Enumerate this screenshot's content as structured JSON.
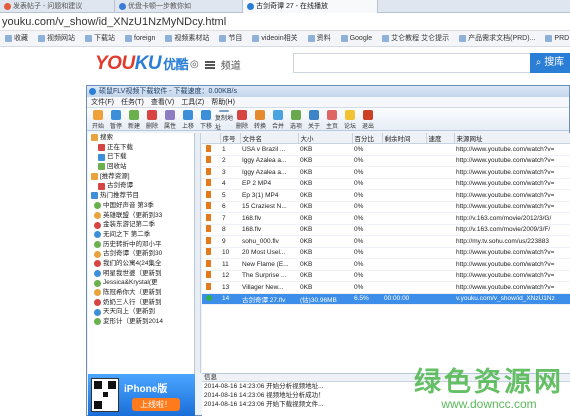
{
  "browser": {
    "tabs": [
      "发表帖子 - 问题和建议",
      "优盘卡顿一步教你如",
      "古剑奇谭 27 - 在线播放"
    ],
    "url": "youku.com/v_show/id_XNzU1NzMyNDcy.html",
    "bookmarks": [
      "收藏",
      "视频网站",
      "下载站",
      "foreign",
      "视频素材站",
      "节目",
      "videoin相关",
      "资料",
      "Google",
      "艾仑教程 艾仑提示",
      "产品需求文档(PRD)...",
      "PRD | 人人都"
    ]
  },
  "youku": {
    "logo_you": "YOU",
    "logo_ku": "KU",
    "logo_cn": "优酷",
    "nav_label": "频道",
    "search_button": "搜库"
  },
  "downloader": {
    "title": "硕鼠FLV视频下载软件 - 下载速度：0.00KB/s",
    "menus": [
      "文件(F)",
      "任务(T)",
      "查看(V)",
      "工具(Z)",
      "帮助(H)"
    ],
    "toolbar": [
      "开始",
      "暂停",
      "新建",
      "删除",
      "属性",
      "上移",
      "下移",
      "复制地址",
      "删除",
      "转换",
      "合并",
      "选项",
      "关于",
      "主页",
      "论坛",
      "退出"
    ],
    "tree": [
      {
        "label": "搜索",
        "level": 0
      },
      {
        "label": "正在下载",
        "level": 1
      },
      {
        "label": "已下载",
        "level": 1
      },
      {
        "label": "回收站",
        "level": 1
      },
      {
        "label": "[推荐资源]",
        "level": 0
      },
      {
        "label": "古剑奇谭",
        "level": 1
      },
      {
        "label": "热门推荐节目",
        "level": 0
      },
      {
        "label": "中国好声音 第3季",
        "level": 2
      },
      {
        "label": "英雄联盟（更新到33",
        "level": 2
      },
      {
        "label": "金装东游记第二季",
        "level": 2
      },
      {
        "label": "无间之下 第二季",
        "level": 2
      },
      {
        "label": "历史转折中的邓小平",
        "level": 2
      },
      {
        "label": "古剑奇谭（更新到30",
        "level": 2
      },
      {
        "label": "我们的公寓4(24集全",
        "level": 2
      },
      {
        "label": "明星我世婆（更新到",
        "level": 2
      },
      {
        "label": "Jessica&Krystal(更",
        "level": 2
      },
      {
        "label": "陈冠希你大（更新到",
        "level": 2
      },
      {
        "label": "奶奶三人行（更新到",
        "level": 2
      },
      {
        "label": "天天向上（更新到",
        "level": 2
      },
      {
        "label": "変形计（更新到2014",
        "level": 2
      }
    ],
    "columns": [
      "",
      "序号",
      "文件名",
      "大小",
      "百分比",
      "剩余时间",
      "速度",
      "来源网址"
    ],
    "rows": [
      [
        "1",
        "USA v Brazil ...",
        "0KB",
        "0%",
        "",
        "",
        "http://www.youtube.com/watch?v="
      ],
      [
        "2",
        "Iggy Azalea a...",
        "0KB",
        "0%",
        "",
        "",
        "http://www.youtube.com/watch?v="
      ],
      [
        "3",
        "Iggy Azalea a...",
        "0KB",
        "0%",
        "",
        "",
        "http://www.youtube.com/watch?v="
      ],
      [
        "4",
        "EP 2 MP4",
        "0KB",
        "0%",
        "",
        "",
        "http://www.youtube.com/watch?v="
      ],
      [
        "5",
        "Ep 3(1) MP4",
        "0KB",
        "0%",
        "",
        "",
        "http://www.youtube.com/watch?v="
      ],
      [
        "6",
        "15 Craziest N...",
        "0KB",
        "0%",
        "",
        "",
        "http://www.youtube.com/watch?v="
      ],
      [
        "7",
        "168.flv",
        "0KB",
        "0%",
        "",
        "",
        "http://v.163.com/movie/2012/3/G/"
      ],
      [
        "8",
        "168.flv",
        "0KB",
        "0%",
        "",
        "",
        "http://v.163.com/movie/2009/3/F/"
      ],
      [
        "9",
        "sohu_000.flv",
        "0KB",
        "0%",
        "",
        "",
        "http://my.tv.sohu.com/us/223883"
      ],
      [
        "10",
        "20 Most Usel...",
        "0KB",
        "0%",
        "",
        "",
        "http://www.youtube.com/watch?v="
      ],
      [
        "11",
        "New Flame (E...",
        "0KB",
        "0%",
        "",
        "",
        "http://www.youtube.com/watch?v="
      ],
      [
        "12",
        "The Surprise ...",
        "0KB",
        "0%",
        "",
        "",
        "http://www.youtube.com/watch?v="
      ],
      [
        "13",
        "Villager New...",
        "0KB",
        "0%",
        "",
        "",
        "http://www.youtube.com/watch?v="
      ],
      [
        "14",
        "古剑奇谭 27.flv",
        "(估)30.96MB",
        "6.5%",
        "00:00:00",
        "",
        "v.youku.com/v_show/id_XNzU1Nz"
      ]
    ],
    "log_header": "信息",
    "log": [
      "2014-08-16 14:23:06 开始分析视频地址...",
      "2014-08-16 14:23:06 视频地址分析成功！",
      "2014-08-16 14:23:06 开始下载视频文件..."
    ],
    "phone_banner": "iPhone版",
    "phone_button": "上线啦！"
  },
  "watermark": {
    "line1": "绿色资源网",
    "line2": "www.downcc.com"
  }
}
